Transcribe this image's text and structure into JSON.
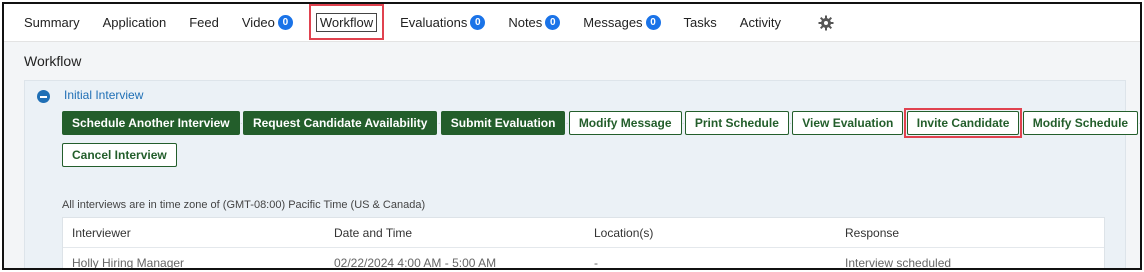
{
  "tabs": [
    {
      "label": "Summary"
    },
    {
      "label": "Application"
    },
    {
      "label": "Feed"
    },
    {
      "label": "Video",
      "badge": "0"
    },
    {
      "label": "Workflow"
    },
    {
      "label": "Evaluations",
      "badge": "0"
    },
    {
      "label": "Notes",
      "badge": "0"
    },
    {
      "label": "Messages",
      "badge": "0"
    },
    {
      "label": "Tasks"
    },
    {
      "label": "Activity"
    }
  ],
  "settings_icon": "gear-icon",
  "page_title": "Workflow",
  "workflow_step": {
    "name": "Initial Interview",
    "collapse_icon": "minus-circle-icon",
    "primary_buttons": [
      "Schedule Another Interview",
      "Request Candidate Availability",
      "Submit Evaluation"
    ],
    "secondary_buttons": [
      "Modify Message",
      "Print Schedule",
      "View Evaluation",
      "Invite Candidate",
      "Modify Schedule"
    ],
    "row2_buttons": [
      "Cancel Interview"
    ]
  },
  "timezone_note": "All interviews are in time zone of (GMT-08:00) Pacific Time (US & Canada)",
  "table": {
    "columns": [
      "Interviewer",
      "Date and Time",
      "Location(s)",
      "Response"
    ],
    "rows": [
      [
        "Holly Hiring Manager",
        "02/22/2024 4:00 AM - 5:00 AM",
        "-",
        "Interview scheduled"
      ]
    ]
  },
  "colors": {
    "primary_button": "#235e2b",
    "link": "#1f6fb5",
    "badge": "#1a73e8",
    "highlight": "#e0424f"
  }
}
